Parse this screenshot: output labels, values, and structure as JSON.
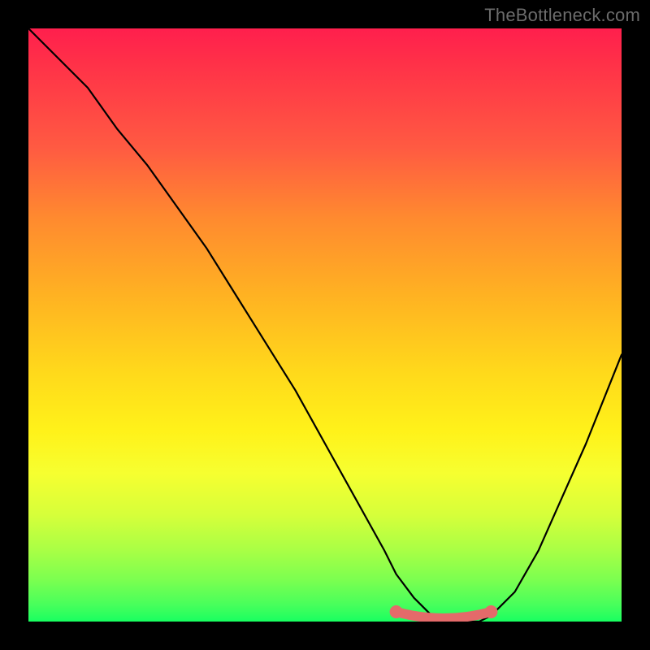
{
  "watermark": "TheBottleneck.com",
  "colors": {
    "background": "#000000",
    "gradient_top": "#ff1f4d",
    "gradient_bottom": "#17ff60",
    "curve": "#000000",
    "plateau": "#e46a6a"
  },
  "chart_data": {
    "type": "line",
    "title": "",
    "xlabel": "",
    "ylabel": "",
    "xlim": [
      0,
      100
    ],
    "ylim": [
      0,
      100
    ],
    "x": [
      0,
      5,
      10,
      15,
      20,
      25,
      30,
      35,
      40,
      45,
      50,
      55,
      60,
      62,
      65,
      68,
      72,
      76,
      78,
      82,
      86,
      90,
      94,
      100
    ],
    "y": [
      100,
      95,
      90,
      83,
      77,
      70,
      63,
      55,
      47,
      39,
      30,
      21,
      12,
      8,
      4,
      1,
      0,
      0,
      1,
      5,
      12,
      21,
      30,
      45
    ],
    "series": [
      {
        "name": "bottleneck-curve",
        "x": [
          0,
          5,
          10,
          15,
          20,
          25,
          30,
          35,
          40,
          45,
          50,
          55,
          60,
          62,
          65,
          68,
          72,
          76,
          78,
          82,
          86,
          90,
          94,
          100
        ],
        "y": [
          100,
          95,
          90,
          83,
          77,
          70,
          63,
          55,
          47,
          39,
          30,
          21,
          12,
          8,
          4,
          1,
          0,
          0,
          1,
          5,
          12,
          21,
          30,
          45
        ]
      }
    ],
    "plateau": {
      "x_start": 62,
      "x_end": 78,
      "y": 0
    }
  }
}
